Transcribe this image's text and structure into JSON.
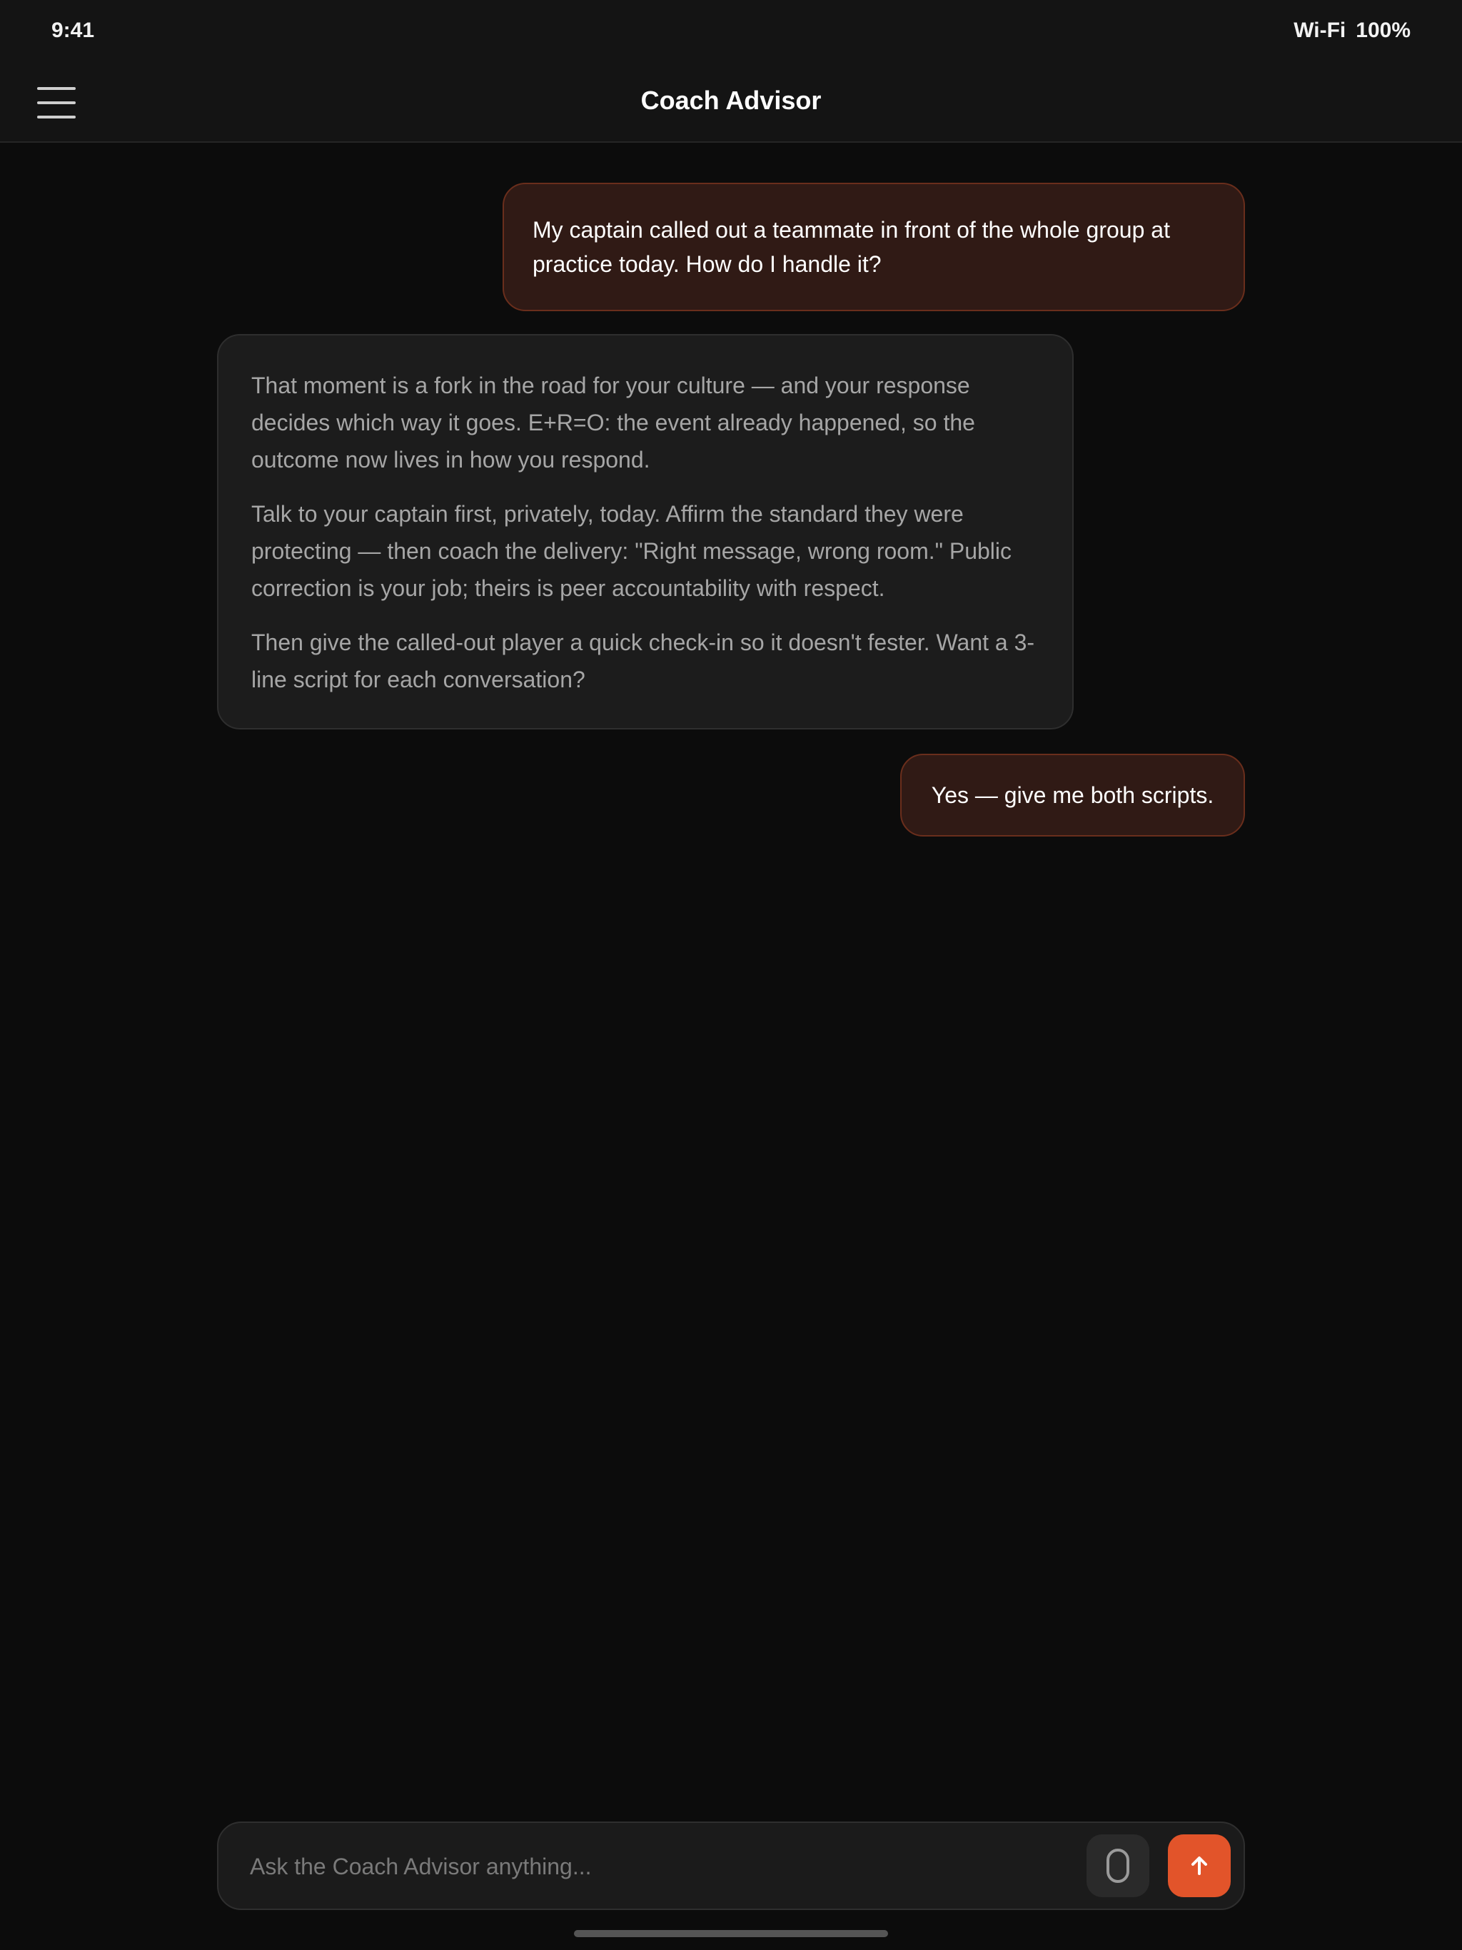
{
  "status_bar": {
    "time": "9:41",
    "wifi": "Wi-Fi",
    "battery": "100%"
  },
  "header": {
    "title": "Coach Advisor",
    "menu_icon": "hamburger-menu-icon"
  },
  "messages": [
    {
      "role": "user",
      "text": "My captain called out a teammate in front of the whole group at practice today. How do I handle it?"
    },
    {
      "role": "assistant",
      "paragraphs": [
        "That moment is a fork in the road for your culture — and your response decides which way it goes. E+R=O: the event already happened, so the outcome now lives in how you respond.",
        "Talk to your captain first, privately, today. Affirm the standard they were protecting — then coach the delivery: \"Right message, wrong room.\"  Public correction is your job; theirs is peer accountability with respect.",
        "Then give the called-out player a quick check-in so it doesn't fester. Want a 3-line script for each conversation?"
      ]
    },
    {
      "role": "user",
      "text": "Yes — give me both scripts."
    }
  ],
  "composer": {
    "placeholder": "Ask the Coach Advisor anything...",
    "mic_icon": "microphone-icon",
    "send_icon": "arrow-up-icon"
  },
  "colors": {
    "background": "#0c0c0c",
    "accent": "#e2542a",
    "user_bubble": "#301a15",
    "assistant_bubble": "#1c1c1c"
  }
}
